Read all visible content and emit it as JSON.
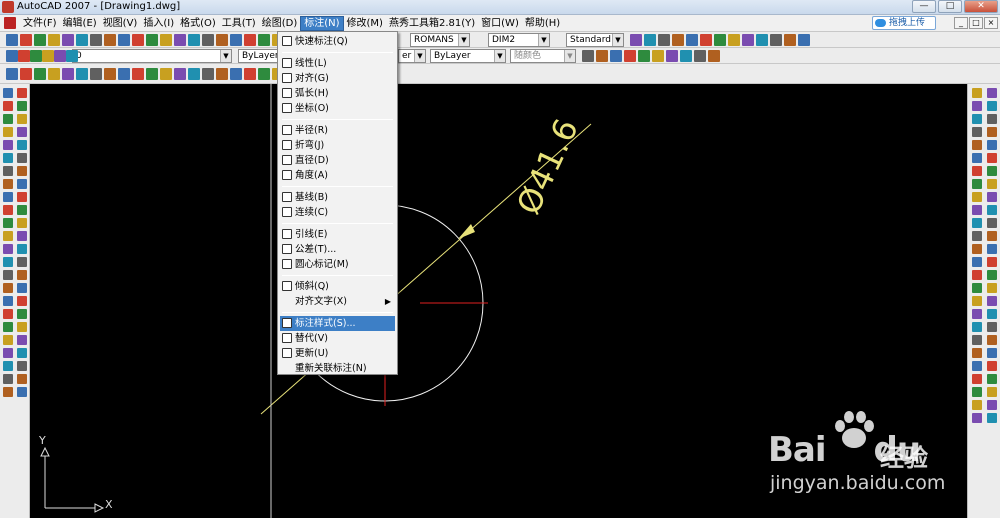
{
  "window": {
    "title": "AutoCAD 2007 - [Drawing1.dwg]",
    "controls": [
      "—",
      "□",
      "✕"
    ]
  },
  "menubar": {
    "items": [
      "文件(F)",
      "编辑(E)",
      "视图(V)",
      "插入(I)",
      "格式(O)",
      "工具(T)",
      "绘图(D)",
      "标注(N)",
      "修改(M)",
      "燕秀工具箱2.81(Y)",
      "窗口(W)",
      "帮助(H)"
    ],
    "active_index": 7,
    "upload_label": "拖拽上传",
    "doc_controls": [
      "_",
      "□",
      "×"
    ]
  },
  "toolbar": {
    "text_style": "ROMANS",
    "dim_style": "DIM2",
    "table_style": "Standard",
    "layer": "0",
    "color": "ByLayer",
    "linetype_suffix": "er",
    "lineweight": "ByLayer",
    "plot_style": "随颜色"
  },
  "dim_menu": {
    "items": [
      {
        "label": "快速标注(Q)",
        "icon": "quick-dim-icon"
      },
      {
        "sep": true
      },
      {
        "label": "线性(L)",
        "icon": "linear-dim-icon"
      },
      {
        "label": "对齐(G)",
        "icon": "aligned-dim-icon"
      },
      {
        "label": "弧长(H)",
        "icon": "arc-length-icon"
      },
      {
        "label": "坐标(O)",
        "icon": "ordinate-icon"
      },
      {
        "sep": true
      },
      {
        "label": "半径(R)",
        "icon": "radius-icon"
      },
      {
        "label": "折弯(J)",
        "icon": "jogged-icon"
      },
      {
        "label": "直径(D)",
        "icon": "diameter-icon"
      },
      {
        "label": "角度(A)",
        "icon": "angular-icon"
      },
      {
        "sep": true
      },
      {
        "label": "基线(B)",
        "icon": "baseline-icon"
      },
      {
        "label": "连续(C)",
        "icon": "continue-icon"
      },
      {
        "sep": true
      },
      {
        "label": "引线(E)",
        "icon": "leader-icon"
      },
      {
        "label": "公差(T)...",
        "icon": "tolerance-icon"
      },
      {
        "label": "圆心标记(M)",
        "icon": "center-mark-icon"
      },
      {
        "sep": true
      },
      {
        "label": "倾斜(Q)",
        "icon": "oblique-icon"
      },
      {
        "label": "对齐文字(X)",
        "icon": "",
        "submenu": true
      },
      {
        "sep": true
      },
      {
        "label": "标注样式(S)...",
        "icon": "dim-style-icon",
        "highlight": true
      },
      {
        "label": "替代(V)",
        "icon": "override-icon"
      },
      {
        "label": "更新(U)",
        "icon": "update-icon"
      },
      {
        "label": "重新关联标注(N)",
        "icon": ""
      }
    ]
  },
  "drawing": {
    "dimension_text": "Ø41.6",
    "ucs_x": "X",
    "ucs_y": "Y",
    "colors": {
      "circle": "#f0f0f0",
      "dim": "#e8e27a",
      "crosshair": "#e02020"
    }
  },
  "watermark": {
    "brand_a": "Bai",
    "brand_b": "du",
    "brand_c": "经验",
    "url": "jingyan.baidu.com"
  }
}
